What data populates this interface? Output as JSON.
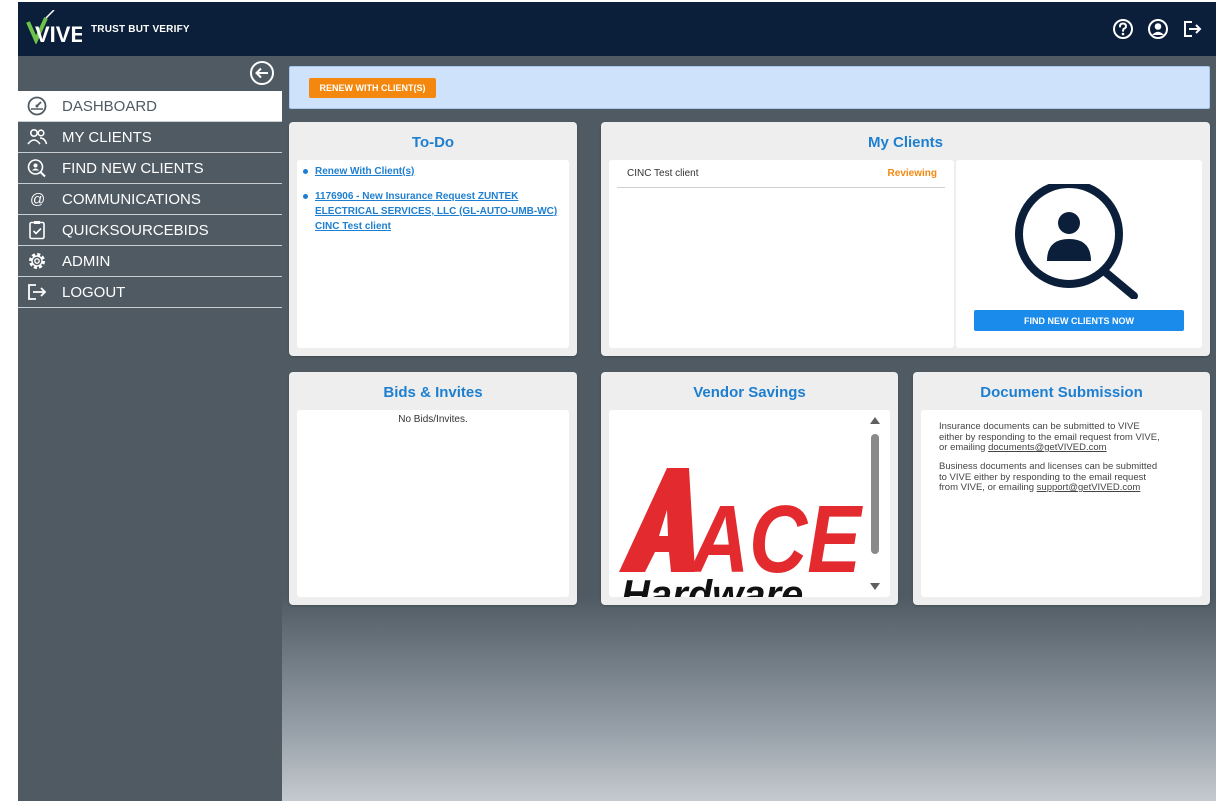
{
  "header": {
    "logo_text": "VIVE",
    "tagline": "TRUST BUT VERIFY",
    "icons": [
      "help-icon",
      "user-account-icon",
      "exit-icon"
    ]
  },
  "sidebar": {
    "items": [
      {
        "label": "DASHBOARD",
        "icon": "dashboard-gauge-icon",
        "active": true
      },
      {
        "label": "MY CLIENTS",
        "icon": "users-icon"
      },
      {
        "label": "FIND NEW CLIENTS",
        "icon": "find-user-icon"
      },
      {
        "label": "COMMUNICATIONS",
        "icon": "at-sign-icon"
      },
      {
        "label": "QUICKSOURCEBIDS",
        "icon": "clipboard-check-icon"
      },
      {
        "label": "ADMIN",
        "icon": "gear-icon"
      },
      {
        "label": "LOGOUT",
        "icon": "logout-icon"
      }
    ]
  },
  "banner": {
    "renew_button": "RENEW WITH CLIENT(S)"
  },
  "todo": {
    "title": "To-Do",
    "items": [
      {
        "lines": [
          "Renew With Client(s)"
        ]
      },
      {
        "lines": [
          "1176906 - New Insurance Request ZUNTEK",
          "ELECTRICAL SERVICES, LLC (GL-AUTO-UMB-WC)",
          "CINC Test client"
        ]
      }
    ]
  },
  "my_clients": {
    "title": "My Clients",
    "rows": [
      {
        "name": "CINC Test client",
        "status": "Reviewing"
      }
    ],
    "find_button": "FIND NEW CLIENTS NOW"
  },
  "bids": {
    "title": "Bids & Invites",
    "empty_text": "No Bids/Invites."
  },
  "vendor": {
    "title": "Vendor Savings",
    "logo_main": "ACE",
    "logo_sub": "Hardware",
    "logo_mark": "®"
  },
  "documents": {
    "title": "Document Submission",
    "para1_lines": [
      "Insurance documents can be submitted to VIVE",
      "either by responding to the email request from VIVE,"
    ],
    "para1_last_prefix": "or emailing ",
    "para1_email": "documents@getVIVED.com",
    "para2_lines": [
      "Business documents and licenses can be submitted",
      "to VIVE either by responding to the email request"
    ],
    "para2_last_prefix": "from VIVE, or emailing ",
    "para2_email": "support@getVIVED.com"
  },
  "colors": {
    "header_bg": "#0b1f3a",
    "sidebar_bg": "#4f5a63",
    "accent_blue": "#1e7fd0",
    "accent_orange": "#f4880f",
    "logo_green": "#6cc24a"
  }
}
